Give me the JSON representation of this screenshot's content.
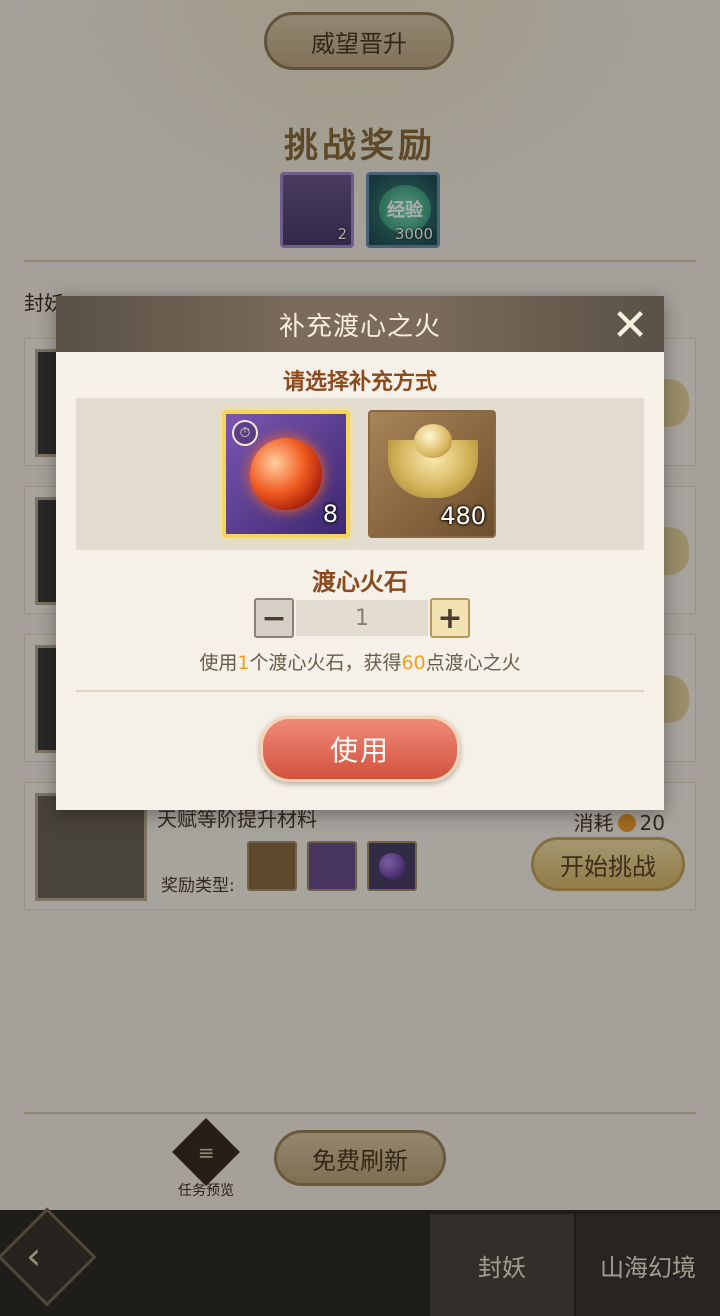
{
  "background": {
    "prestige_button": "威望晋升",
    "reward_title": "挑战奖励",
    "rewards": [
      {
        "count": "2"
      },
      {
        "label": "经验",
        "count": "3000"
      }
    ],
    "hint_text": "封妖",
    "card4": {
      "item_name": "天赋等阶提升材料",
      "cost_label": "消耗",
      "cost_value": "20",
      "reward_type_label": "奖励类型:",
      "start_button": "开始挑战"
    },
    "task_preview_label": "任务预览",
    "refresh_button": "免费刷新"
  },
  "bottom_nav": {
    "tabs": [
      "封妖",
      "山海幻境"
    ]
  },
  "modal": {
    "title": "补充渡心之火",
    "subtitle": "请选择补充方式",
    "options": [
      {
        "icon": "fire-stone-icon",
        "qty": "8",
        "selected": true
      },
      {
        "icon": "gold-ingot-icon",
        "qty": "480",
        "selected": false
      }
    ],
    "item_title": "渡心火石",
    "quantity": "1",
    "desc_prefix": "使用",
    "desc_count": "1",
    "desc_middle": "个渡心火石，获得",
    "desc_points": "60",
    "desc_suffix": "点渡心之火",
    "use_button": "使用"
  },
  "colors": {
    "accent_orange": "#f2a022",
    "use_button": "#d2523e",
    "selected_border": "#f5d65a"
  }
}
